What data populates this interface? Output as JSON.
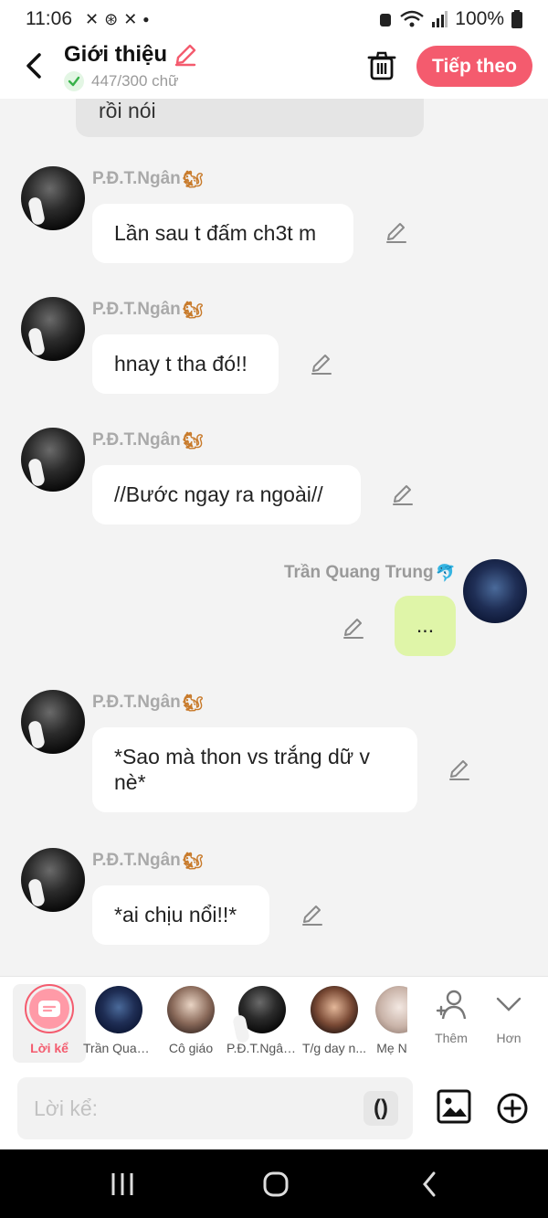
{
  "status_bar": {
    "time": "11:06",
    "battery": "100%"
  },
  "header": {
    "title": "Giới thiệu",
    "count": "447/300 chữ",
    "next_label": "Tiếp theo"
  },
  "chat": {
    "previous_text": "rồi nói",
    "messages": [
      {
        "sender": "P.Đ.T.Ngân",
        "text": "Lần sau t đấm ch3t m"
      },
      {
        "sender": "P.Đ.T.Ngân",
        "text": "hnay t tha đó!!"
      },
      {
        "sender": "P.Đ.T.Ngân",
        "text": "//Bước ngay ra ngoài//"
      },
      {
        "sender": "Trần Quang Trung",
        "text": "..."
      },
      {
        "sender": "P.Đ.T.Ngân",
        "text": "*Sao mà thon vs trắng dữ v nè*"
      },
      {
        "sender": "P.Đ.T.Ngân",
        "text": "*ai chịu nổi!!*"
      }
    ]
  },
  "characters": [
    {
      "label": "Lời kể"
    },
    {
      "label": "Trần Quan..."
    },
    {
      "label": "Cô giáo"
    },
    {
      "label": "P.Đ.T.Ngân..."
    },
    {
      "label": "T/g day n..."
    },
    {
      "label": "Mẹ N"
    },
    {
      "label": "Thêm"
    },
    {
      "label": "Hơn"
    }
  ],
  "input": {
    "placeholder": "Lời kể:",
    "paren_label": "()"
  },
  "colors": {
    "accent": "#f45b6e",
    "user_bubble": "#dff5a8",
    "background": "#f3f3f3"
  }
}
